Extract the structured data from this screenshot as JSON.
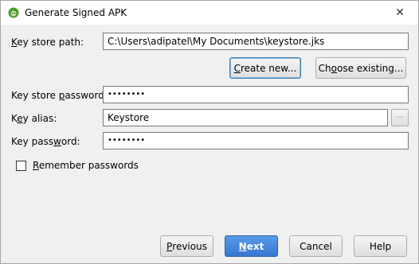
{
  "window": {
    "title": "Generate Signed APK",
    "close_symbol": "✕",
    "icon": "android-studio-icon"
  },
  "form": {
    "key_store_path": {
      "label_accel": "K",
      "label_rest": "ey store path:",
      "value": "C:\\Users\\adipatel\\My Documents\\keystore.jks"
    },
    "create_new": {
      "accel": "C",
      "rest": "reate new..."
    },
    "choose_existing": {
      "prefix": "Ch",
      "accel": "o",
      "rest": "ose existing..."
    },
    "key_store_password": {
      "label_prefix": "Key store ",
      "label_accel": "p",
      "label_rest": "assword:",
      "value": "••••••••"
    },
    "key_alias": {
      "label_prefix": "K",
      "label_accel": "e",
      "label_rest": "y alias:",
      "value": "Keystore",
      "browse": "···"
    },
    "key_password": {
      "label_prefix": "Key pass",
      "label_accel": "w",
      "label_rest": "ord:",
      "value": "••••••••"
    },
    "remember": {
      "accel": "R",
      "rest": "emember passwords",
      "checked": false
    }
  },
  "footer": {
    "previous": {
      "accel": "P",
      "rest": "revious"
    },
    "next": {
      "accel": "N",
      "rest": "ext"
    },
    "cancel": "Cancel",
    "help": "Help"
  }
}
